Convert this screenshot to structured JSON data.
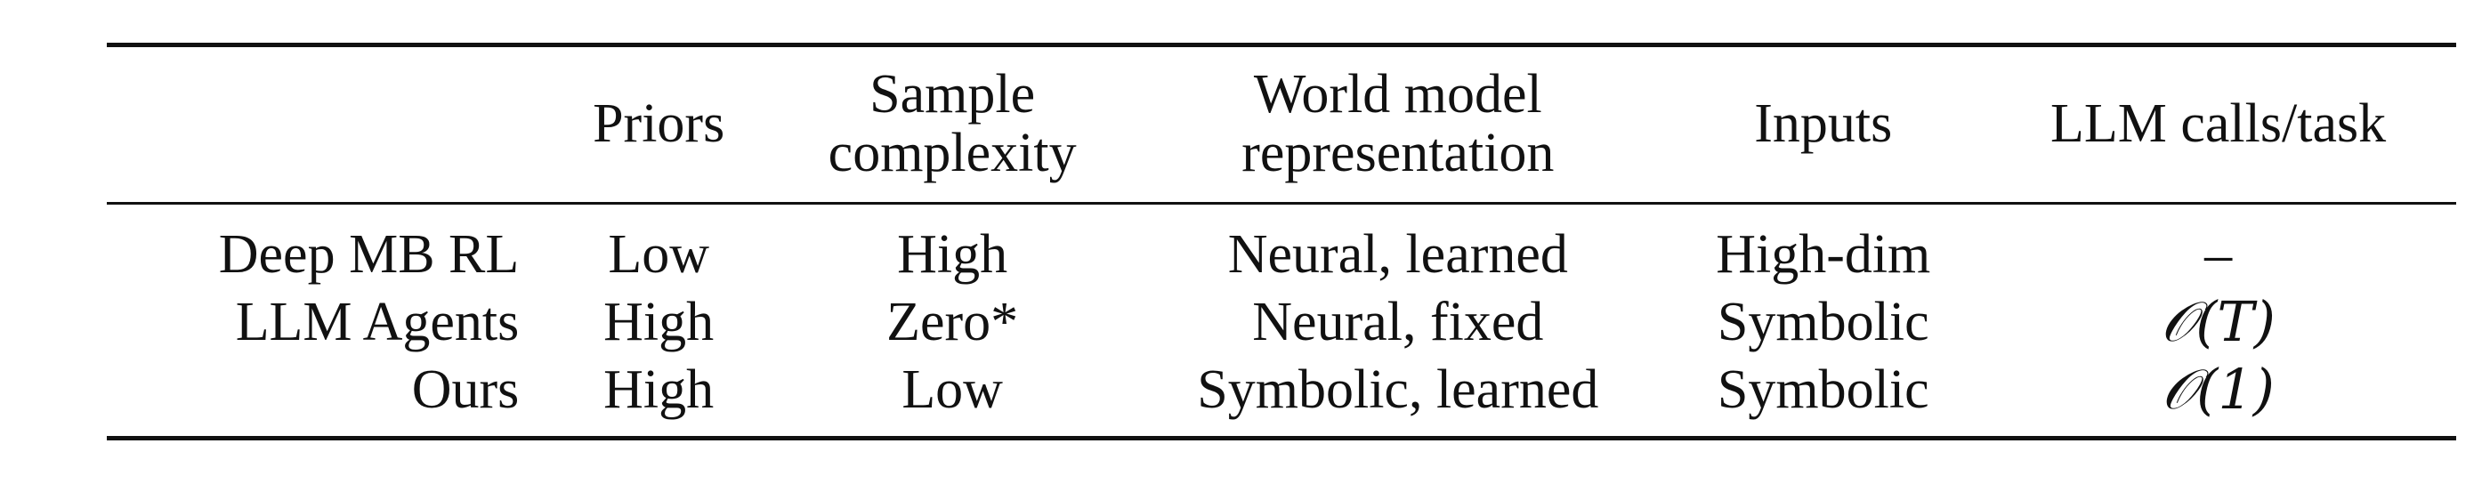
{
  "table": {
    "headers": [
      {
        "lines": [
          ""
        ]
      },
      {
        "lines": [
          "Priors"
        ]
      },
      {
        "lines": [
          "Sample",
          "complexity"
        ]
      },
      {
        "lines": [
          "World model",
          "representation"
        ]
      },
      {
        "lines": [
          "Inputs"
        ]
      },
      {
        "lines": [
          "LLM calls/task"
        ]
      }
    ],
    "rows": [
      {
        "method": "Deep MB RL",
        "priors": "Low",
        "sample_complexity": "High",
        "world_model": "Neural, learned",
        "inputs": "High-dim",
        "llm_calls": "–"
      },
      {
        "method": "LLM Agents",
        "priors": "High",
        "sample_complexity": "Zero*",
        "world_model": "Neural, fixed",
        "inputs": "Symbolic",
        "llm_calls": "𝒪(T)"
      },
      {
        "method": "Ours",
        "priors": "High",
        "sample_complexity": "Low",
        "world_model": "Symbolic, learned",
        "inputs": "Symbolic",
        "llm_calls": "𝒪(1)"
      }
    ]
  }
}
